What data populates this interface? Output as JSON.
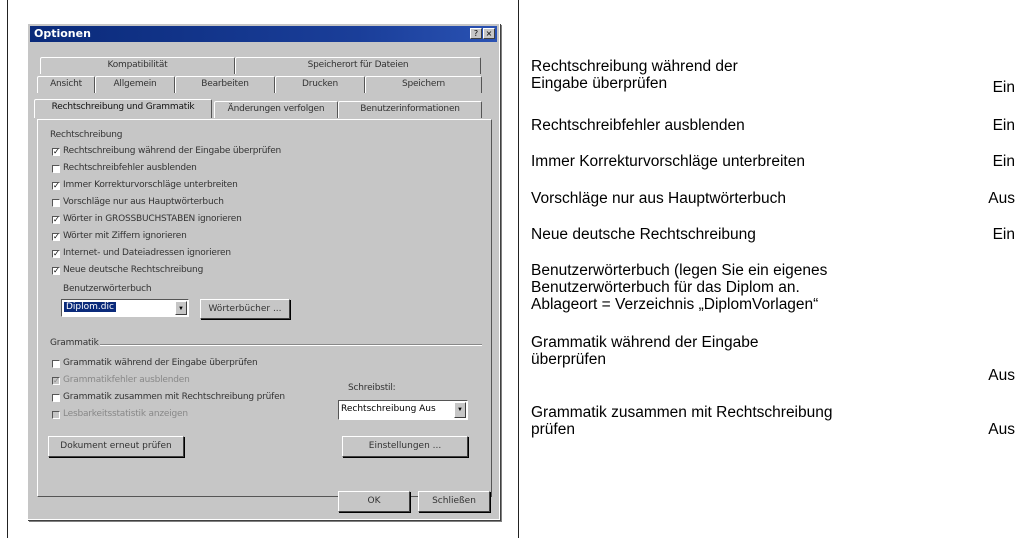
{
  "dialog": {
    "title": "Optionen",
    "window_buttons": [
      "?",
      "×"
    ],
    "tabs_row1": [
      "Kompatibilität",
      "Speicherort für Dateien"
    ],
    "tabs_row2": [
      "Ansicht",
      "Allgemein",
      "Bearbeiten",
      "Drucken",
      "Speichern"
    ],
    "tabs_row3": [
      "Rechtschreibung und Grammatik",
      "Änderungen verfolgen",
      "Benutzerinformationen"
    ],
    "spelling_group_label": "Rechtschreibung",
    "spelling_options": [
      {
        "label": "Rechtschreibung während der Eingabe überprüfen",
        "checked": true,
        "disabled": false
      },
      {
        "label": "Rechtschreibfehler ausblenden",
        "checked": false,
        "disabled": false
      },
      {
        "label": "Immer Korrekturvorschläge unterbreiten",
        "checked": true,
        "disabled": false
      },
      {
        "label": "Vorschläge nur aus Hauptwörterbuch",
        "checked": false,
        "disabled": false
      },
      {
        "label": "Wörter in GROSSBUCHSTABEN ignorieren",
        "checked": true,
        "disabled": false
      },
      {
        "label": "Wörter mit Ziffern ignorieren",
        "checked": true,
        "disabled": false
      },
      {
        "label": "Internet- und Dateiadressen ignorieren",
        "checked": true,
        "disabled": false
      },
      {
        "label": "Neue deutsche Rechtschreibung",
        "checked": true,
        "disabled": false
      }
    ],
    "user_dict_label": "Benutzerwörterbuch",
    "user_dict_value": "Diplom.dic",
    "dictionaries_button": "Wörterbücher ...",
    "grammar_group_label": "Grammatik",
    "grammar_options": [
      {
        "label": "Grammatik während der Eingabe überprüfen",
        "checked": false,
        "disabled": false
      },
      {
        "label": "Grammatikfehler ausblenden",
        "checked": true,
        "disabled": true
      },
      {
        "label": "Grammatik zusammen mit Rechtschreibung prüfen",
        "checked": false,
        "disabled": false
      },
      {
        "label": "Lesbarkeitsstatistik anzeigen",
        "checked": false,
        "disabled": true
      }
    ],
    "style_label": "Schreibstil:",
    "style_value": "Rechtschreibung Aus",
    "recheck_button": "Dokument erneut prüfen",
    "settings_button": "Einstellungen ...",
    "ok_button": "OK",
    "close_button": "Schließen"
  },
  "table_rows": [
    {
      "description": "Rechtschreibung während der\nEingabe überprüfen",
      "value": "Ein"
    },
    {
      "description": "Rechtschreibfehler ausblenden",
      "value": "Ein"
    },
    {
      "description": "Immer Korrekturvorschläge unterbreiten",
      "value": "Ein"
    },
    {
      "description": "Vorschläge nur aus Hauptwörterbuch",
      "value": "Aus"
    },
    {
      "description": "Neue deutsche Rechtschreibung",
      "value": "Ein"
    },
    {
      "description": "Benutzerwörterbuch (legen Sie ein eigenes\nBenutzerwörterbuch für das Diplom an.\nAblageort = Verzeichnis „DiplomVorlagen“",
      "value": ""
    },
    {
      "description": "Grammatik während der Eingabe\nüberprüfen",
      "value": "Aus"
    },
    {
      "description": "Grammatik zusammen mit Rechtschreibung\nprüfen",
      "value": "Aus"
    }
  ]
}
